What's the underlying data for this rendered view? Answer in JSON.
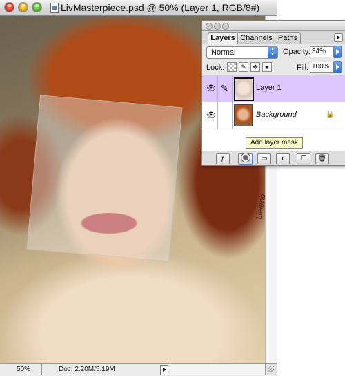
{
  "document": {
    "title": "LivMasterpiece.psd @ 50% (Layer 1, RGB/8#)",
    "zoom": "50%",
    "doc_size": "Doc: 2.20M/5.19M",
    "signature": "Lieftrop"
  },
  "layers_panel": {
    "tabs": [
      "Layers",
      "Channels",
      "Paths"
    ],
    "active_tab": "Layers",
    "blend_mode": "Normal",
    "opacity_label": "Opacity:",
    "opacity": "34%",
    "lock_label": "Lock:",
    "fill_label": "Fill:",
    "fill": "100%",
    "layers": [
      {
        "name": "Layer 1",
        "selected": true
      },
      {
        "name": "Background",
        "selected": false
      }
    ],
    "tooltip": "Add layer mask",
    "selection_color": "#dcc8ff"
  },
  "icons": [
    "eye-icon",
    "brush-icon",
    "lock-icon",
    "layer-styles-icon",
    "layer-mask-icon",
    "layer-set-icon",
    "adjustment-layer-icon",
    "new-layer-icon",
    "trash-icon"
  ]
}
